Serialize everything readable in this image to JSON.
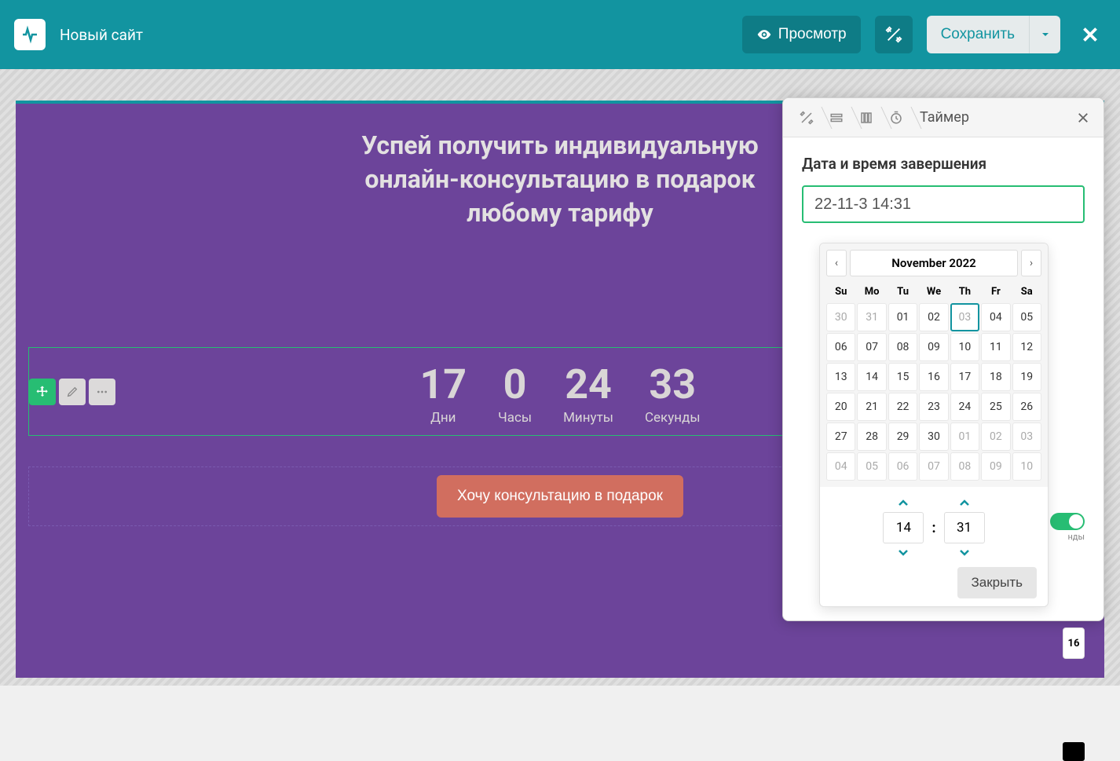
{
  "header": {
    "site_name": "Новый сайт",
    "preview_label": "Просмотр",
    "save_label": "Сохранить"
  },
  "promo": {
    "line1": "Успей получить индивидуальную",
    "line2": "онлайн-консультацию в подарок",
    "line3": "любому тарифу"
  },
  "countdown": {
    "days": {
      "value": "17",
      "label": "Дни"
    },
    "hours": {
      "value": "0",
      "label": "Часы"
    },
    "minutes": {
      "value": "24",
      "label": "Минуты"
    },
    "seconds": {
      "value": "33",
      "label": "Секунды"
    }
  },
  "cta": {
    "label": "Хочу консультацию в подарок"
  },
  "panel": {
    "breadcrumb_final": "Таймер",
    "field_label": "Дата и время завершения",
    "datetime_value": "22-11-3 14:31",
    "calendar": {
      "title": "November 2022",
      "prev": "‹",
      "next": "›",
      "dows": [
        "Su",
        "Mo",
        "Tu",
        "We",
        "Th",
        "Fr",
        "Sa"
      ],
      "weeks": [
        [
          {
            "d": "30",
            "m": true
          },
          {
            "d": "31",
            "m": true
          },
          {
            "d": "01"
          },
          {
            "d": "02"
          },
          {
            "d": "03",
            "sel": true
          },
          {
            "d": "04"
          },
          {
            "d": "05"
          }
        ],
        [
          {
            "d": "06"
          },
          {
            "d": "07"
          },
          {
            "d": "08"
          },
          {
            "d": "09"
          },
          {
            "d": "10"
          },
          {
            "d": "11"
          },
          {
            "d": "12"
          }
        ],
        [
          {
            "d": "13"
          },
          {
            "d": "14"
          },
          {
            "d": "15"
          },
          {
            "d": "16"
          },
          {
            "d": "17"
          },
          {
            "d": "18"
          },
          {
            "d": "19"
          }
        ],
        [
          {
            "d": "20"
          },
          {
            "d": "21"
          },
          {
            "d": "22"
          },
          {
            "d": "23"
          },
          {
            "d": "24"
          },
          {
            "d": "25"
          },
          {
            "d": "26"
          }
        ],
        [
          {
            "d": "27"
          },
          {
            "d": "28"
          },
          {
            "d": "29"
          },
          {
            "d": "30"
          },
          {
            "d": "01",
            "m": true
          },
          {
            "d": "02",
            "m": true
          },
          {
            "d": "03",
            "m": true
          }
        ],
        [
          {
            "d": "04",
            "m": true
          },
          {
            "d": "05",
            "m": true
          },
          {
            "d": "06",
            "m": true
          },
          {
            "d": "07",
            "m": true
          },
          {
            "d": "08",
            "m": true
          },
          {
            "d": "09",
            "m": true
          },
          {
            "d": "10",
            "m": true
          }
        ]
      ]
    },
    "time": {
      "hour": "14",
      "minute": "31"
    },
    "close_btn": "Закрыть",
    "side_fontsize": "16",
    "side_toggle_label": "нды"
  }
}
